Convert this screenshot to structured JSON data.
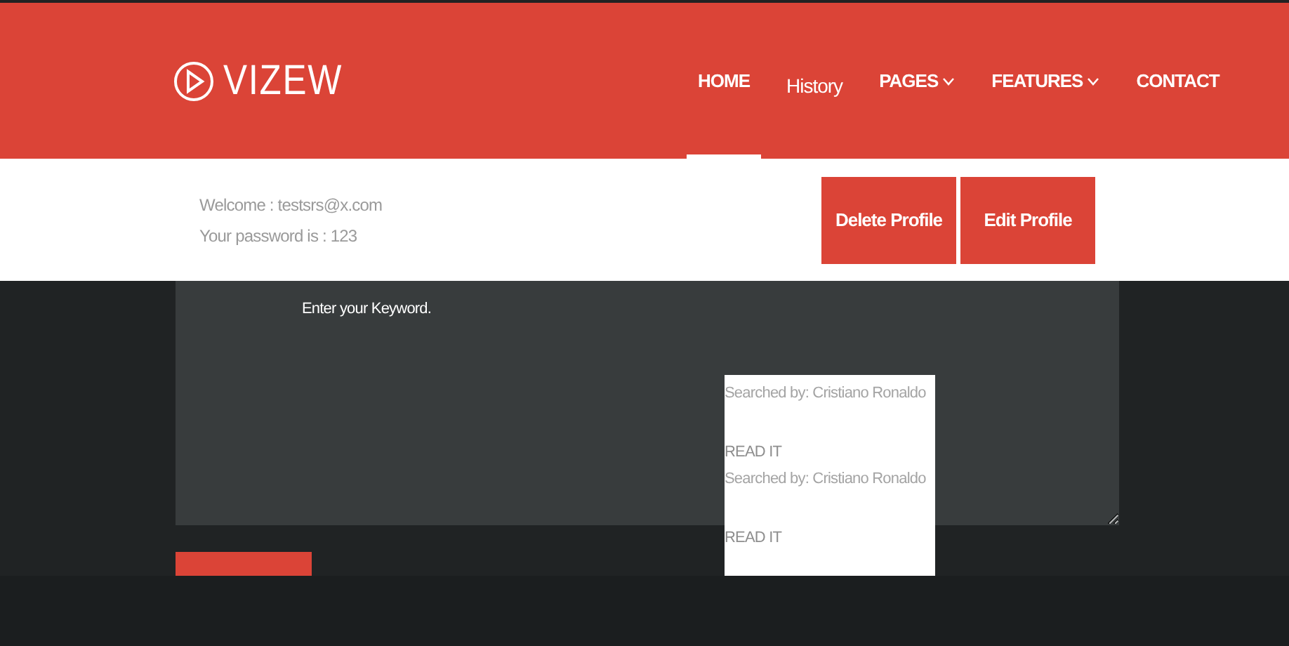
{
  "header": {
    "logo": "VIZEW",
    "nav": [
      {
        "label": "HOME",
        "selected": true,
        "dropdown": false,
        "kind": "caps"
      },
      {
        "label": "History",
        "selected": false,
        "dropdown": false,
        "kind": "plain"
      },
      {
        "label": "PAGES",
        "selected": false,
        "dropdown": true,
        "kind": "caps"
      },
      {
        "label": "FEATURES",
        "selected": false,
        "dropdown": true,
        "kind": "caps"
      },
      {
        "label": "CONTACT",
        "selected": false,
        "dropdown": false,
        "kind": "caps"
      }
    ]
  },
  "profile": {
    "lines": [
      "Welcome : testsrs@x.com",
      "Your password is : 123"
    ],
    "buttons": [
      "Delete Profile",
      "Edit Profile"
    ]
  },
  "search": {
    "placeholder": "Enter your Keyword.",
    "results": [
      {
        "text": "Searched by: Cristiano Ronaldo",
        "link": "READ IT"
      },
      {
        "text": "Searched by: Cristiano Ronaldo",
        "link": "READ IT"
      }
    ]
  }
}
